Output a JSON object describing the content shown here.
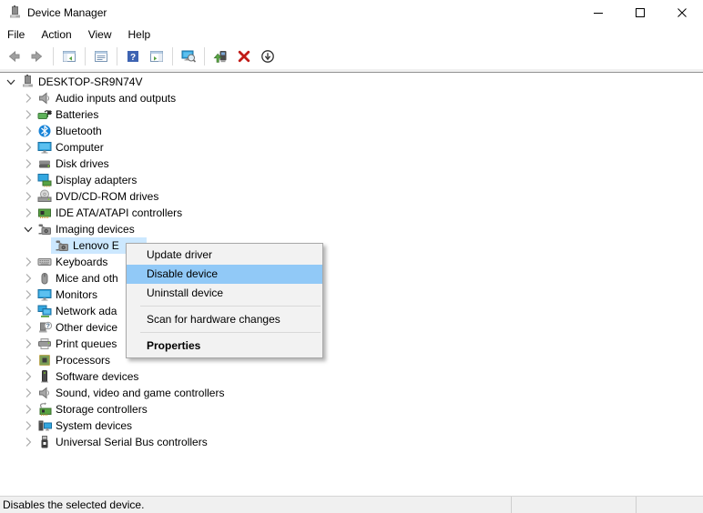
{
  "window": {
    "title": "Device Manager",
    "app_icon": "device-manager-icon",
    "controls": [
      {
        "name": "minimize",
        "icon": "minimize-icon"
      },
      {
        "name": "maximize",
        "icon": "maximize-icon"
      },
      {
        "name": "close",
        "icon": "close-icon"
      }
    ]
  },
  "menubar": {
    "items": [
      "File",
      "Action",
      "View",
      "Help"
    ]
  },
  "toolbar": {
    "buttons": [
      {
        "name": "back",
        "icon": "back-icon"
      },
      {
        "name": "forward",
        "icon": "forward-icon"
      },
      {
        "separator": true
      },
      {
        "name": "show-hide-console-tree",
        "icon": "console-tree-icon"
      },
      {
        "separator": true
      },
      {
        "name": "properties",
        "icon": "properties-window-icon"
      },
      {
        "separator": true
      },
      {
        "name": "help",
        "icon": "help-icon"
      },
      {
        "name": "show-hide-action-pane",
        "icon": "action-pane-icon"
      },
      {
        "separator": true
      },
      {
        "name": "scan-for-hardware-changes",
        "icon": "scan-icon"
      },
      {
        "separator": true
      },
      {
        "name": "update-driver",
        "icon": "update-driver-icon"
      },
      {
        "name": "uninstall-device",
        "icon": "uninstall-icon"
      },
      {
        "name": "disable-device",
        "icon": "disable-icon"
      }
    ]
  },
  "tree": {
    "items": [
      {
        "label": "DESKTOP-SR9N74V",
        "icon": "computer-host-icon",
        "level": 0,
        "chevron": "expanded",
        "selected": false
      },
      {
        "label": "Audio inputs and outputs",
        "icon": "audio-icon",
        "level": 1,
        "chevron": "collapsed",
        "selected": false
      },
      {
        "label": "Batteries",
        "icon": "battery-icon",
        "level": 1,
        "chevron": "collapsed",
        "selected": false
      },
      {
        "label": "Bluetooth",
        "icon": "bluetooth-icon",
        "level": 1,
        "chevron": "collapsed",
        "selected": false
      },
      {
        "label": "Computer",
        "icon": "monitor-icon",
        "level": 1,
        "chevron": "collapsed",
        "selected": false
      },
      {
        "label": "Disk drives",
        "icon": "disk-icon",
        "level": 1,
        "chevron": "collapsed",
        "selected": false
      },
      {
        "label": "Display adapters",
        "icon": "display-adapter-icon",
        "level": 1,
        "chevron": "collapsed",
        "selected": false
      },
      {
        "label": "DVD/CD-ROM drives",
        "icon": "dvd-icon",
        "level": 1,
        "chevron": "collapsed",
        "selected": false
      },
      {
        "label": "IDE ATA/ATAPI controllers",
        "icon": "ide-controller-icon",
        "level": 1,
        "chevron": "collapsed",
        "selected": false
      },
      {
        "label": "Imaging devices",
        "icon": "imaging-icon",
        "level": 1,
        "chevron": "expanded",
        "selected": false
      },
      {
        "label": "Lenovo E",
        "icon": "imaging-icon",
        "level": 2,
        "chevron": "none",
        "selected": true
      },
      {
        "label": "Keyboards",
        "icon": "keyboard-icon",
        "level": 1,
        "chevron": "collapsed",
        "selected": false
      },
      {
        "label": "Mice and oth",
        "icon": "mouse-icon",
        "level": 1,
        "chevron": "collapsed",
        "selected": false
      },
      {
        "label": "Monitors",
        "icon": "monitor-icon",
        "level": 1,
        "chevron": "collapsed",
        "selected": false
      },
      {
        "label": "Network ada",
        "icon": "network-icon",
        "level": 1,
        "chevron": "collapsed",
        "selected": false
      },
      {
        "label": "Other device",
        "icon": "other-device-icon",
        "level": 1,
        "chevron": "collapsed",
        "selected": false
      },
      {
        "label": "Print queues",
        "icon": "printer-icon",
        "level": 1,
        "chevron": "collapsed",
        "selected": false
      },
      {
        "label": "Processors",
        "icon": "processor-icon",
        "level": 1,
        "chevron": "collapsed",
        "selected": false
      },
      {
        "label": "Software devices",
        "icon": "software-device-icon",
        "level": 1,
        "chevron": "collapsed",
        "selected": false
      },
      {
        "label": "Sound, video and game controllers",
        "icon": "sound-icon",
        "level": 1,
        "chevron": "collapsed",
        "selected": false
      },
      {
        "label": "Storage controllers",
        "icon": "storage-icon",
        "level": 1,
        "chevron": "collapsed",
        "selected": false
      },
      {
        "label": "System devices",
        "icon": "system-device-icon",
        "level": 1,
        "chevron": "collapsed",
        "selected": false
      },
      {
        "label": "Universal Serial Bus controllers",
        "icon": "usb-icon",
        "level": 1,
        "chevron": "collapsed",
        "selected": false
      }
    ]
  },
  "context_menu": {
    "items": [
      {
        "label": "Update driver",
        "highlighted": false,
        "bold": false
      },
      {
        "label": "Disable device",
        "highlighted": true,
        "bold": false
      },
      {
        "label": "Uninstall device",
        "highlighted": false,
        "bold": false
      },
      {
        "separator": true
      },
      {
        "label": "Scan for hardware changes",
        "highlighted": false,
        "bold": false
      },
      {
        "separator": true
      },
      {
        "label": "Properties",
        "highlighted": false,
        "bold": true
      }
    ]
  },
  "statusbar": {
    "text": "Disables the selected device."
  },
  "colors": {
    "menu_highlight": "#91c9f7",
    "tree_selection": "#cce8ff",
    "menu_background": "#f2f2f2",
    "statusbar_background": "#f0f0f0",
    "uninstall_red": "#c11b17",
    "help_blue": "#3e63b2"
  }
}
